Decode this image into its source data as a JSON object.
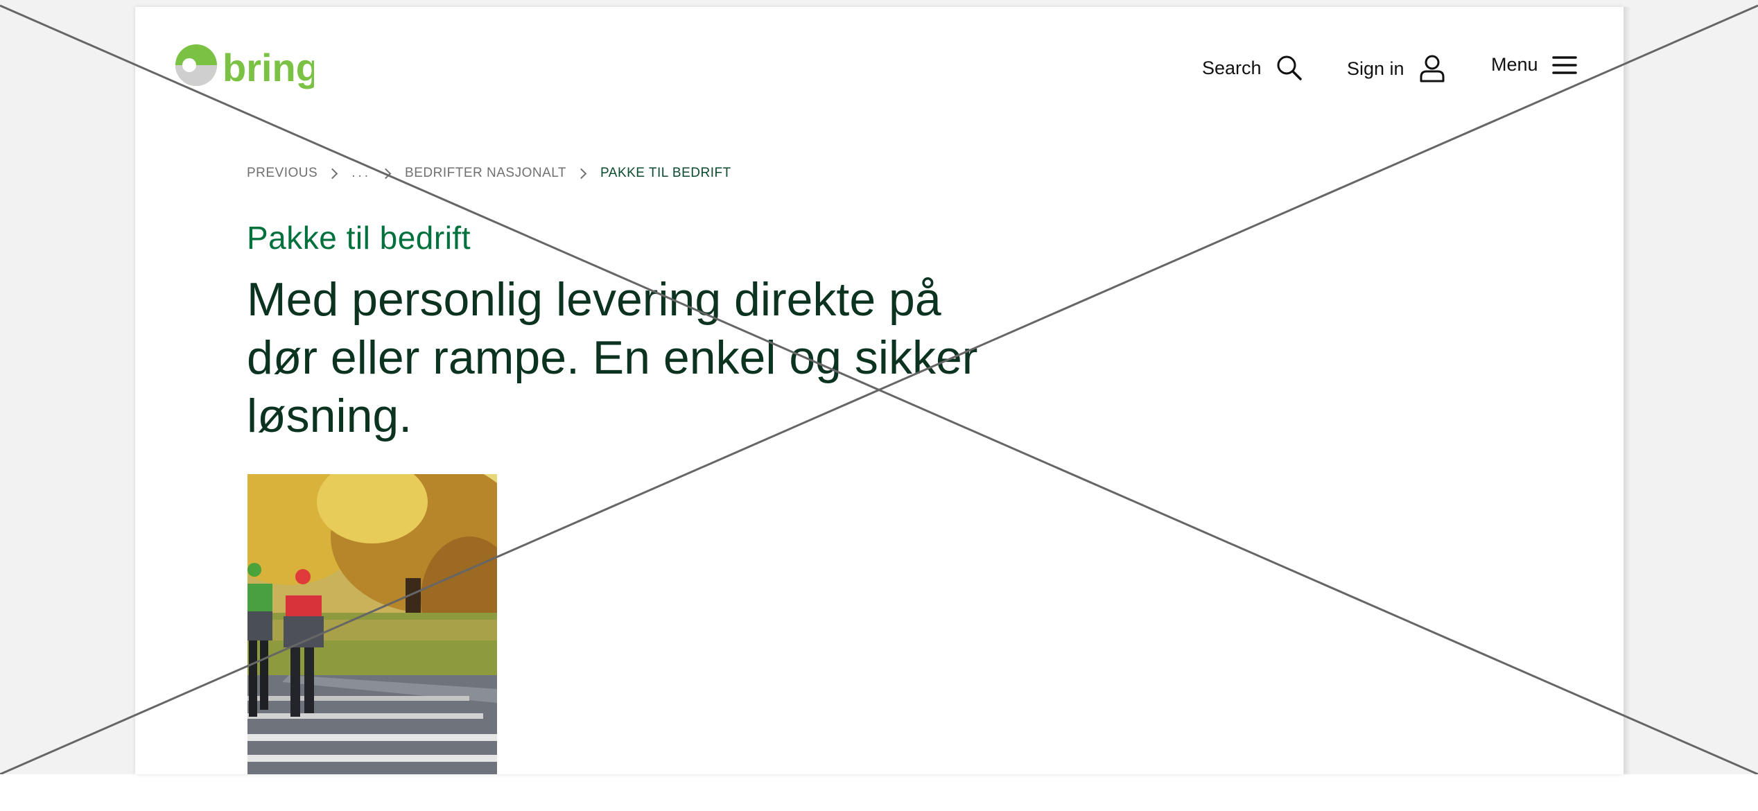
{
  "header": {
    "logo_text": "bring",
    "search_label": "Search",
    "signin_label": "Sign in",
    "menu_label": "Menu"
  },
  "breadcrumb": {
    "previous": "PREVIOUS",
    "ellipsis": "...",
    "parent": "BEDRIFTER NASJONALT",
    "current": "PAKKE TIL BEDRIFT"
  },
  "page": {
    "eyebrow": "Pakke til bedrift",
    "lead": "Med personlig levering direkte på dør eller rampe. En enkel og sikker løsning."
  },
  "icons": {
    "search": "search-icon",
    "user": "user-icon",
    "menu": "hamburger-menu-icon",
    "chevron": "chevron-right-icon"
  },
  "colors": {
    "brand_green": "#7bc144",
    "heading_green": "#00703c",
    "dark_text": "#0b3320"
  }
}
